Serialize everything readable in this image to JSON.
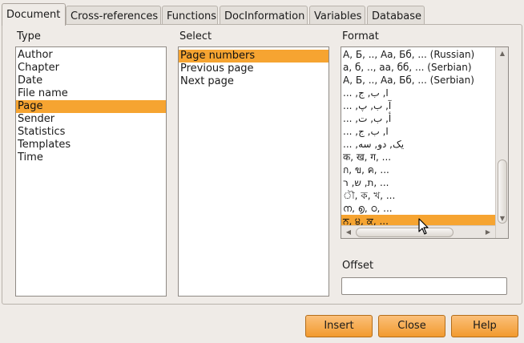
{
  "tabs": [
    {
      "label": "Document",
      "active": true
    },
    {
      "label": "Cross-references",
      "active": false
    },
    {
      "label": "Functions",
      "active": false
    },
    {
      "label": "DocInformation",
      "active": false
    },
    {
      "label": "Variables",
      "active": false
    },
    {
      "label": "Database",
      "active": false
    }
  ],
  "type": {
    "label": "Type",
    "items": [
      "Author",
      "Chapter",
      "Date",
      "File name",
      "Page",
      "Sender",
      "Statistics",
      "Templates",
      "Time"
    ],
    "selected": "Page"
  },
  "select": {
    "label": "Select",
    "items": [
      "Page numbers",
      "Previous page",
      "Next page"
    ],
    "selected": "Page numbers"
  },
  "format": {
    "label": "Format",
    "items": [
      "А, Б, .., Аа, Бб, ... (Russian)",
      "а, б, .., аа, бб, ... (Serbian)",
      "А, Б, .., Аа, Бб, ... (Serbian)",
      "... ,ﺍ, ﺏ, ﺝ",
      "... ,ﺁ, ﺏ, ﭖ",
      "... ,ﺃ, ﺏ, ﺕ",
      "... ,ﺍ, ﺏ, ﺝ",
      "... ,ﯾﮏ, ﺩﻭ, ﺳﻪ",
      "क, ख, ग, ...",
      "ก, ข, ค, ...",
      "ת, ש, ר, ...",
      "ৗ, ক, খ, ...",
      "ന, ൭, ഠ, ...",
      "ਨ, ੪, ਕ, ..."
    ],
    "selected_index": 13
  },
  "offset": {
    "label": "Offset",
    "value": ""
  },
  "buttons": {
    "insert": "Insert",
    "close": "Close",
    "help": "Help"
  },
  "colors": {
    "accent": "#f6a431",
    "background": "#efebe7"
  }
}
